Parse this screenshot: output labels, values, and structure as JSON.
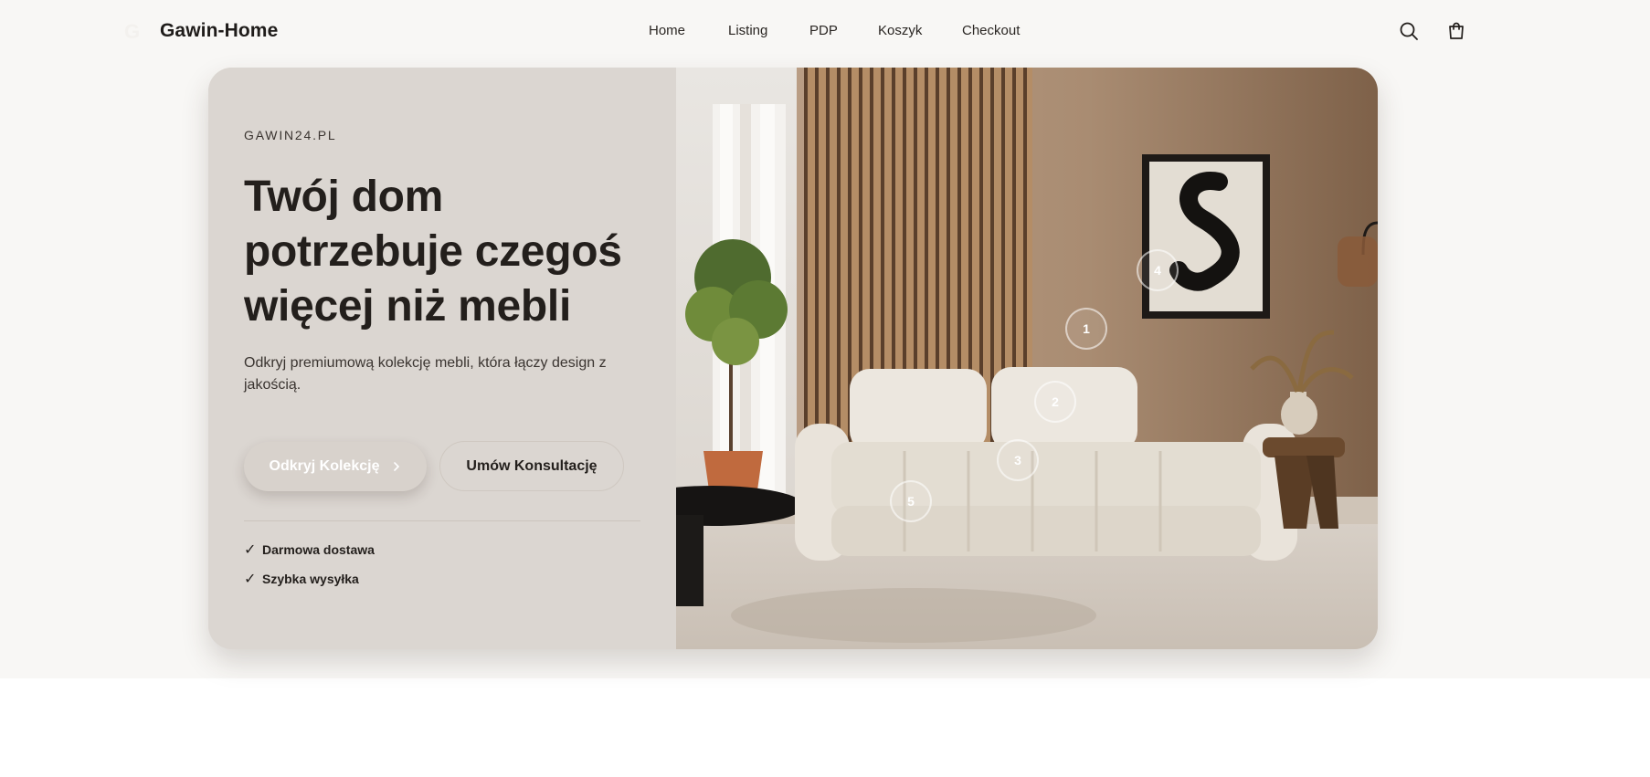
{
  "header": {
    "logo_mark": "G",
    "brand": "Gawin-Home",
    "nav": [
      "Home",
      "Listing",
      "PDP",
      "Koszyk",
      "Checkout"
    ],
    "icons": {
      "search": "search-icon",
      "cart": "cart-icon"
    }
  },
  "hero": {
    "eyebrow": "GAWIN24.PL",
    "headline": [
      "Twój dom",
      "potrzebuje czegoś",
      "więcej niż mebli"
    ],
    "subtitle": "Odkryj premiumową kolekcję mebli, która łączy design z jakością.",
    "primary_button": "Odkryj Kolekcję",
    "primary_button_icon": "chevron-right-icon",
    "secondary_button": "Umów Konsultację",
    "features": [
      "Darmowa dostawa",
      "Szybka wysyłka"
    ],
    "check_icon": "✓",
    "hotspots": [
      "1",
      "2",
      "3",
      "4",
      "5"
    ]
  },
  "colors": {
    "page_bg": "#f8f7f5",
    "hero_left_bg": "#dbd6d1",
    "text_dark": "#231f1c",
    "wall": "#a78a70"
  }
}
